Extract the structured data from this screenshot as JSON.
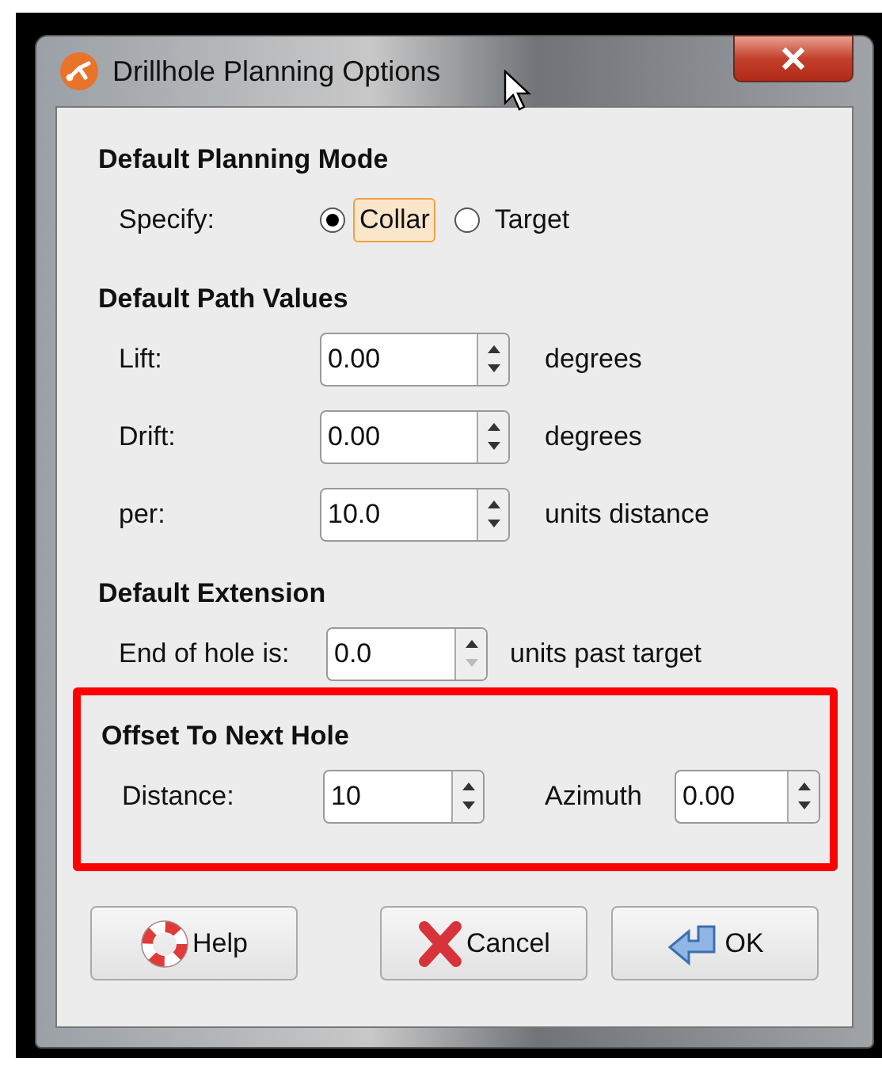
{
  "window": {
    "title": "Drillhole Planning Options"
  },
  "planning_mode": {
    "heading": "Default Planning Mode",
    "label": "Specify:",
    "options": [
      {
        "label": "Collar",
        "selected": true,
        "focused": true
      },
      {
        "label": "Target",
        "selected": false,
        "focused": false
      }
    ]
  },
  "path_values": {
    "heading": "Default Path Values",
    "fields": [
      {
        "label": "Lift:",
        "value": "0.00",
        "unit": "degrees",
        "down_disabled": false
      },
      {
        "label": "Drift:",
        "value": "0.00",
        "unit": "degrees",
        "down_disabled": false
      },
      {
        "label": "per:",
        "value": "10.0",
        "unit": "units distance",
        "down_disabled": false
      }
    ]
  },
  "extension": {
    "heading": "Default Extension",
    "field": {
      "label": "End of hole is:",
      "value": "0.0",
      "unit": "units past target",
      "down_disabled": true
    }
  },
  "offset": {
    "heading": "Offset To Next Hole",
    "highlighted": true,
    "fields": [
      {
        "label": "Distance:",
        "value": "10",
        "down_disabled": false
      },
      {
        "label": "Azimuth",
        "value": "0.00",
        "down_disabled": false
      }
    ]
  },
  "buttons": [
    {
      "kind": "help",
      "label": "Help"
    },
    {
      "kind": "cancel",
      "label": "Cancel"
    },
    {
      "kind": "ok",
      "label": "OK"
    }
  ]
}
